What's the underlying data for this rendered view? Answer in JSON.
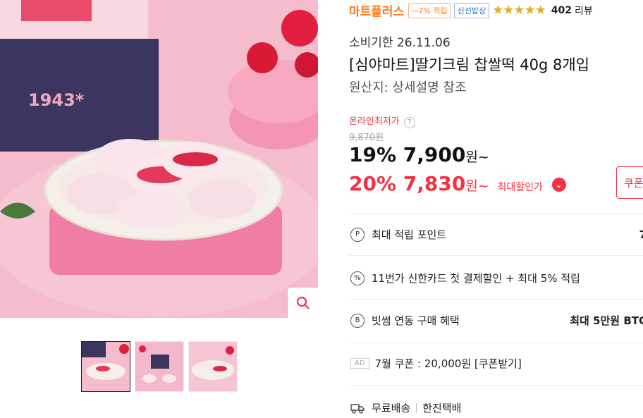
{
  "product": {
    "brand": "마트플러스",
    "badge_points": "~7% 적립",
    "badge_fresh": "신선밥상",
    "stars": "★★★★★",
    "review_count": "402",
    "review_label": "리뷰",
    "expiry": "소비기한 26.11.06",
    "title": "[심야마트]딸기크림 찹쌀떡 40g 8개입",
    "origin": "원산지: 상세설명 참조"
  },
  "price": {
    "online_lowest_label": "온라인최저가",
    "help_icon": "?",
    "original": "9,870원",
    "discount1_pct": "19%",
    "discount1_price": "7,900",
    "won_suffix": "원~",
    "discount2_pct": "20%",
    "discount2_price": "7,830",
    "won_suffix2": "원~",
    "max_discount_label": "최대할인가",
    "coupon_button": "쿠폰"
  },
  "benefits": [
    {
      "icon": "P",
      "label": "최대 적립 포인트",
      "value": "7"
    },
    {
      "icon": "%",
      "label": "11번가 신한카드 첫 결제할인 + 최대 5% 적립",
      "value": ""
    },
    {
      "icon": "B",
      "label": "빗썸 연동 구매 혜택",
      "value": "최대 5만원 BTC"
    }
  ],
  "ad": {
    "tag": "AD",
    "text": "7월 쿠폰 : 20,000원 [쿠폰받기]"
  },
  "shipping": {
    "label": "무료배송",
    "carrier": "한진택배"
  },
  "hero_box_text": "1943*",
  "colors": {
    "accent": "#f43142",
    "brand": "#ff7a1a"
  }
}
